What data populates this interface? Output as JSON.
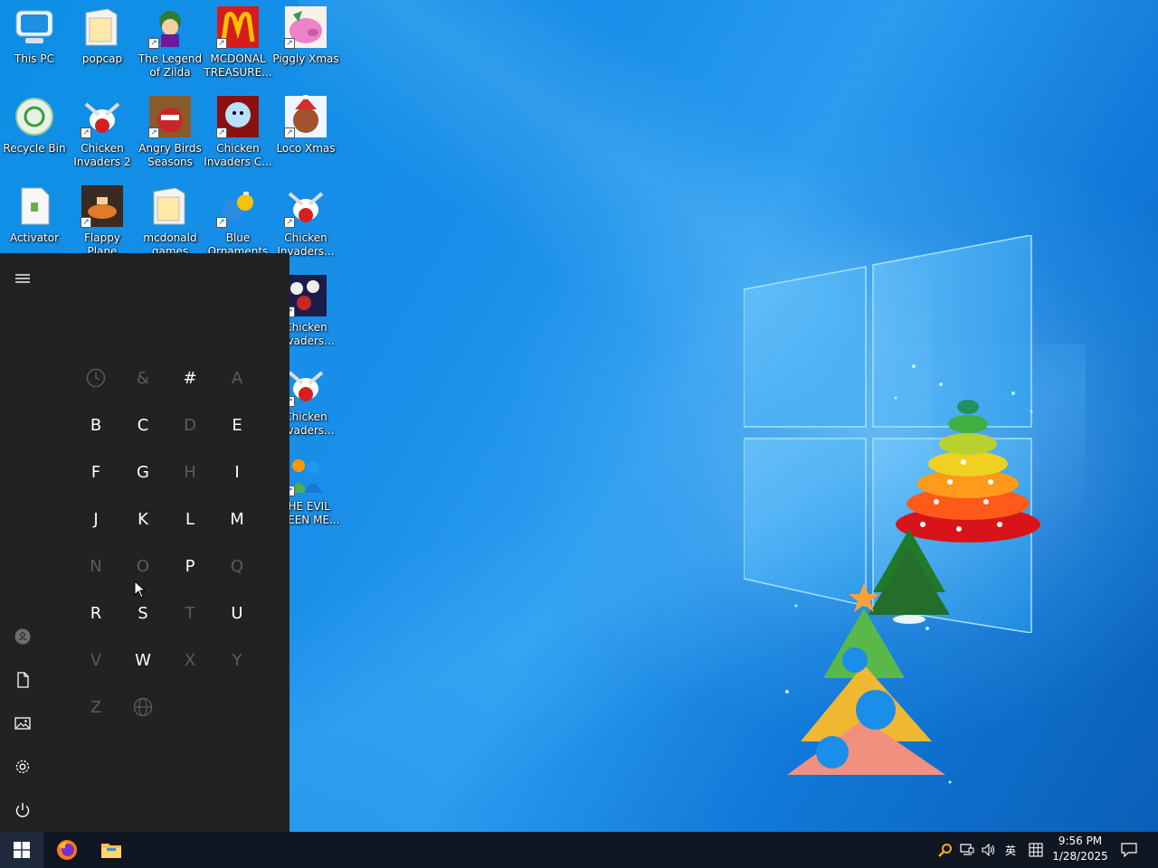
{
  "desktop": {
    "icons": [
      {
        "label": "This PC",
        "icon": "computer-icon"
      },
      {
        "label": "popcap",
        "icon": "folder-icon"
      },
      {
        "label": "The Legend of Zilda",
        "icon": "game-zilda-icon"
      },
      {
        "label": "MCDONAL TREASURE...",
        "icon": "mcdonalds-icon"
      },
      {
        "label": "Piggly Xmas",
        "icon": "pig-icon"
      },
      {
        "label": "Recycle Bin",
        "icon": "recycle-bin-icon"
      },
      {
        "label": "Chicken Invaders 2",
        "icon": "chicken-icon"
      },
      {
        "label": "Angry Birds Seasons",
        "icon": "angry-birds-icon"
      },
      {
        "label": "Chicken Invaders C...",
        "icon": "chicken-snowman-icon"
      },
      {
        "label": "Loco Xmas",
        "icon": "teddy-bear-icon"
      },
      {
        "label": "Activator",
        "icon": "file-icon"
      },
      {
        "label": "Flappy Plane",
        "icon": "plane-icon"
      },
      {
        "label": "mcdonald games",
        "icon": "folder-icon"
      },
      {
        "label": "Blue Ornaments",
        "icon": "ornaments-icon"
      },
      {
        "label": "Chicken Invaders...",
        "icon": "chicken-icon"
      },
      {
        "label": "Chicken Invaders...",
        "icon": "chicken-eggs-icon"
      },
      {
        "label": "Chicken Invaders...",
        "icon": "chicken-icon"
      },
      {
        "label": "THE EVIL GREEN ME...",
        "icon": "messenger-icon"
      }
    ]
  },
  "start_menu": {
    "letters": [
      {
        "text": "",
        "enabled": false,
        "icon": "clock-icon"
      },
      {
        "text": "&",
        "enabled": false
      },
      {
        "text": "#",
        "enabled": true
      },
      {
        "text": "A",
        "enabled": false
      },
      {
        "text": "B",
        "enabled": true
      },
      {
        "text": "C",
        "enabled": true
      },
      {
        "text": "D",
        "enabled": false
      },
      {
        "text": "E",
        "enabled": true
      },
      {
        "text": "F",
        "enabled": true
      },
      {
        "text": "G",
        "enabled": true
      },
      {
        "text": "H",
        "enabled": false
      },
      {
        "text": "I",
        "enabled": true
      },
      {
        "text": "J",
        "enabled": true
      },
      {
        "text": "K",
        "enabled": true
      },
      {
        "text": "L",
        "enabled": true
      },
      {
        "text": "M",
        "enabled": true
      },
      {
        "text": "N",
        "enabled": false
      },
      {
        "text": "O",
        "enabled": false
      },
      {
        "text": "P",
        "enabled": true
      },
      {
        "text": "Q",
        "enabled": false
      },
      {
        "text": "R",
        "enabled": true
      },
      {
        "text": "S",
        "enabled": true
      },
      {
        "text": "T",
        "enabled": false
      },
      {
        "text": "U",
        "enabled": true
      },
      {
        "text": "V",
        "enabled": false
      },
      {
        "text": "W",
        "enabled": true
      },
      {
        "text": "X",
        "enabled": false
      },
      {
        "text": "Y",
        "enabled": false
      },
      {
        "text": "Z",
        "enabled": false
      },
      {
        "text": "",
        "enabled": false,
        "icon": "globe-icon"
      }
    ],
    "rail": [
      "menu-icon",
      "user-icon",
      "documents-icon",
      "pictures-icon",
      "settings-icon",
      "power-icon"
    ]
  },
  "taskbar": {
    "pinned": [
      "windows-start-icon",
      "firefox-icon",
      "file-explorer-icon"
    ],
    "tray": {
      "ime_label": "英",
      "time": "9:56 PM",
      "date": "1/28/2025"
    }
  },
  "colors": {
    "start_bg": "#222222",
    "taskbar_bg": "#101722",
    "desktop_blue": "#1a8ee8",
    "letter_dim": "#5c5c5c"
  }
}
